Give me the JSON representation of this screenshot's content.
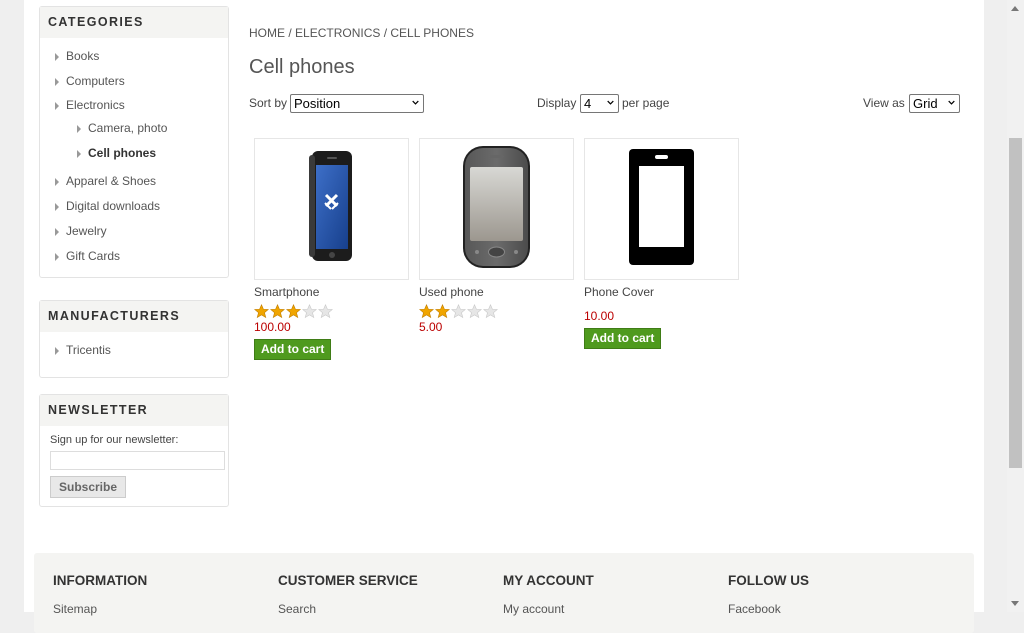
{
  "sidebar": {
    "categories": {
      "title": "CATEGORIES",
      "items": [
        {
          "label": "Books"
        },
        {
          "label": "Computers"
        },
        {
          "label": "Electronics"
        },
        {
          "label": "Camera, photo"
        },
        {
          "label": "Cell phones"
        },
        {
          "label": "Apparel & Shoes"
        },
        {
          "label": "Digital downloads"
        },
        {
          "label": "Jewelry"
        },
        {
          "label": "Gift Cards"
        }
      ]
    },
    "manufacturers": {
      "title": "MANUFACTURERS",
      "items": [
        {
          "label": "Tricentis"
        }
      ]
    },
    "newsletter": {
      "title": "NEWSLETTER",
      "prompt": "Sign up for our newsletter:",
      "email_value": "",
      "subscribe_label": "Subscribe"
    }
  },
  "breadcrumb": {
    "home": "Home",
    "sep": " / ",
    "level1": "Electronics",
    "current": "Cell phones"
  },
  "page_title": "Cell phones",
  "toolbar": {
    "sort_label": "Sort by",
    "sort_value": "Position",
    "display_label": "Display",
    "display_value": "4",
    "per_page_label": "per page",
    "view_label": "View as",
    "view_value": "Grid"
  },
  "products": [
    {
      "name": "Smartphone",
      "rating": 3,
      "max_rating": 5,
      "price": "100.00",
      "cart_label": "Add to cart"
    },
    {
      "name": "Used phone",
      "rating": 2,
      "max_rating": 5,
      "price": "5.00"
    },
    {
      "name": "Phone Cover",
      "price": "10.00",
      "cart_label": "Add to cart"
    }
  ],
  "footer": {
    "columns": [
      {
        "heading": "INFORMATION",
        "first_link": "Sitemap"
      },
      {
        "heading": "CUSTOMER SERVICE",
        "first_link": "Search"
      },
      {
        "heading": "MY ACCOUNT",
        "first_link": "My account"
      },
      {
        "heading": "FOLLOW US",
        "first_link": "Facebook"
      }
    ]
  },
  "colors": {
    "price": "#bb0000",
    "cart_button": "#4f9a1e",
    "star_filled": "#f0a500",
    "star_empty": "#dddddd"
  },
  "icons": {
    "list_arrow": "caret-right-icon",
    "select_caret": "chevron-down-icon",
    "rating": "star-icon"
  }
}
